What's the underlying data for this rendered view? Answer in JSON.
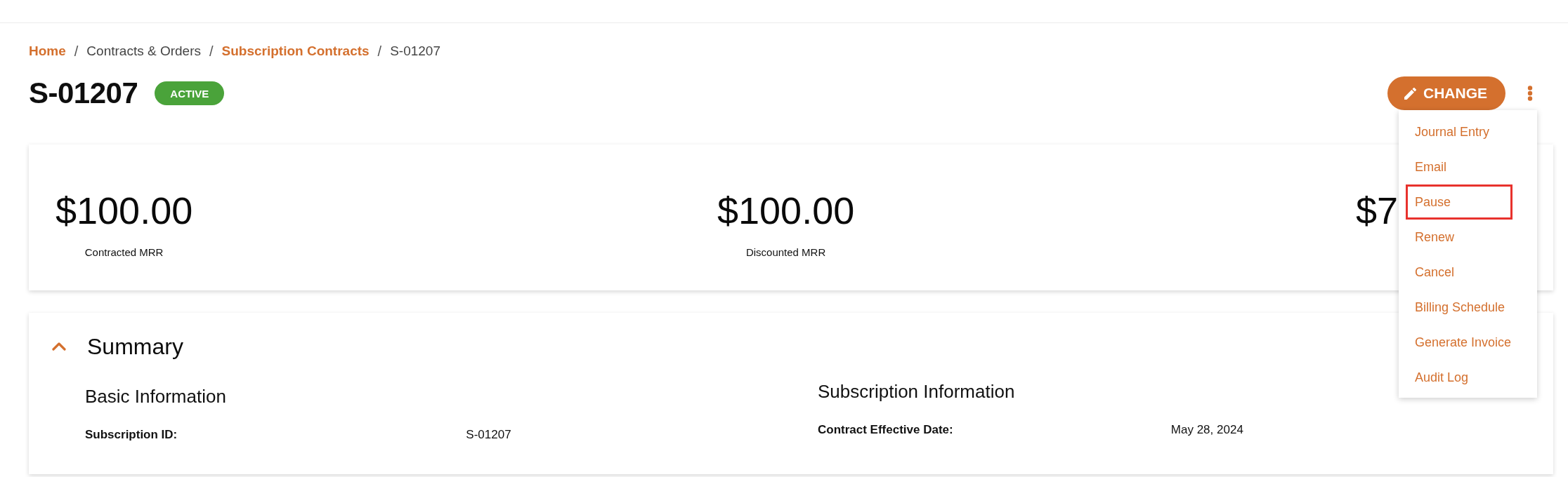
{
  "breadcrumb": [
    {
      "label": "Home",
      "link": true,
      "separator": "/"
    },
    {
      "label": "Contracts & Orders",
      "link": false,
      "separator": "/"
    },
    {
      "label": "Subscription Contracts",
      "link": true,
      "separator": "/"
    },
    {
      "label": "S-01207",
      "link": false
    }
  ],
  "header": {
    "title": "S-01207",
    "status": "ACTIVE",
    "change_button": "CHANGE"
  },
  "actions_menu": {
    "open": true,
    "items": [
      {
        "label": "Journal Entry",
        "highlighted": false
      },
      {
        "label": "Email",
        "highlighted": false
      },
      {
        "label": "Pause",
        "highlighted": true
      },
      {
        "label": "Renew",
        "highlighted": false
      },
      {
        "label": "Cancel",
        "highlighted": false
      },
      {
        "label": "Billing Schedule",
        "highlighted": false
      },
      {
        "label": "Generate Invoice",
        "highlighted": false
      },
      {
        "label": "Audit Log",
        "highlighted": false
      }
    ]
  },
  "metrics": [
    {
      "value": "$100.00",
      "label": "Contracted MRR"
    },
    {
      "value": "$100.00",
      "label": "Discounted MRR"
    },
    {
      "value": "$7"
    }
  ],
  "summary": {
    "title": "Summary",
    "expanded": true,
    "sections": [
      {
        "title": "Basic Information",
        "fields": [
          {
            "label": "Subscription ID:",
            "value": "S-01207"
          }
        ]
      },
      {
        "title": "Subscription Information",
        "fields": [
          {
            "label": "Contract Effective Date:",
            "value": "May 28, 2024"
          }
        ]
      }
    ]
  }
}
